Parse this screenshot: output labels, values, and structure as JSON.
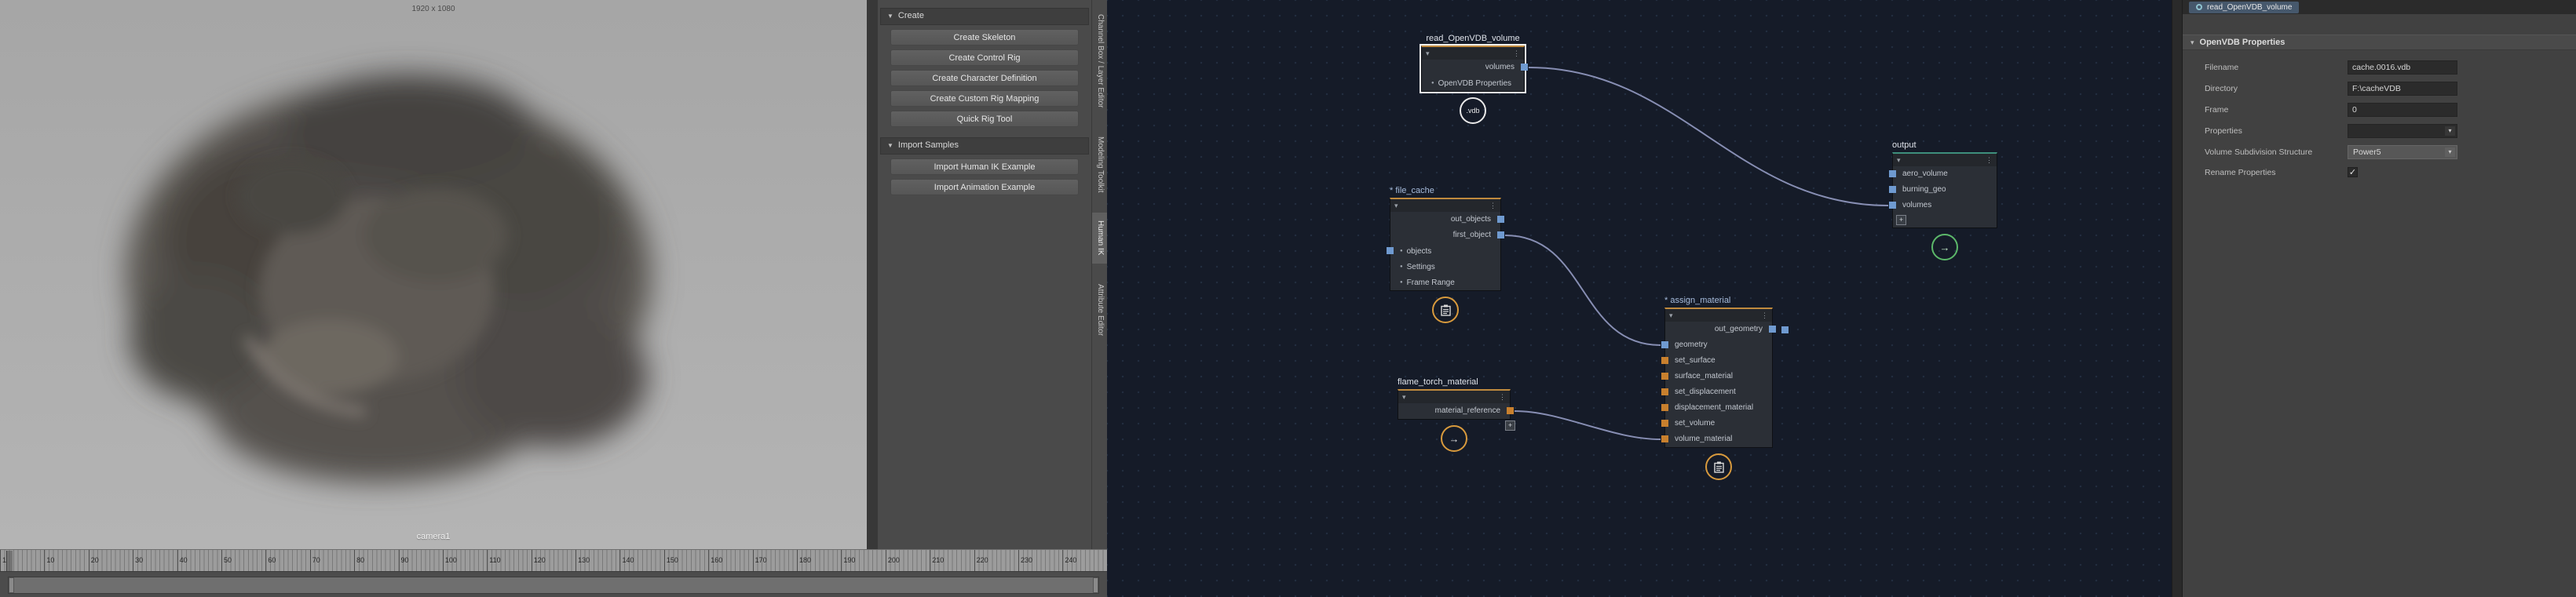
{
  "colors": {
    "wire": "#8d95bb",
    "conn-blue": "#6f9ad0",
    "conn-orange": "#c8802e",
    "badge-yellow": "#d89a3d",
    "badge-green": "#5cb86a",
    "accent-orange": "#c08a3e",
    "accent-teal": "#3e8f7c",
    "selection": "#f2f2f2"
  },
  "icons": {
    "collapse": "▾",
    "dots": "⋮",
    "bullet": "●",
    "plus": "+",
    "arrow_right": "→",
    "chevron_down": "▾",
    "check": "✓",
    "section_triangle": "▼"
  },
  "viewport": {
    "resolution_label": "1920 x 1080",
    "camera_label": "camera1"
  },
  "timeline": {
    "ticks": [
      "1",
      "10",
      "20",
      "30",
      "40",
      "50",
      "60",
      "70",
      "80",
      "90",
      "100",
      "110",
      "120",
      "130",
      "140",
      "150",
      "160",
      "170",
      "180",
      "190",
      "200",
      "210",
      "220",
      "230",
      "240"
    ]
  },
  "humanik": {
    "create_section": {
      "label": "Create",
      "buttons": [
        "Create Skeleton",
        "Create Control Rig",
        "Create Character Definition",
        "Create Custom Rig Mapping",
        "Quick Rig Tool"
      ]
    },
    "import_section": {
      "label": "Import Samples",
      "buttons": [
        "Import Human IK Example",
        "Import Animation Example"
      ]
    }
  },
  "side_tabs": {
    "channel_box": "Channel Box / Layer Editor",
    "modeling_toolkit": "Modeling Toolkit",
    "human_ik": "Human IK",
    "attribute_editor": "Attribute Editor"
  },
  "node_editor": {
    "nodes": {
      "read": {
        "title": "read_OpenVDB_volume",
        "badge": ".vdb",
        "rows": {
          "volumes": "volumes",
          "props": "OpenVDB Properties"
        }
      },
      "output": {
        "title": "output",
        "rows": {
          "aero": "aero_volume",
          "burning": "burning_geo",
          "volumes": "volumes"
        }
      },
      "file_cache": {
        "title": "* file_cache",
        "rows": {
          "out_objects": "out_objects",
          "first_object": "first_object",
          "objects": "objects",
          "settings": "Settings",
          "frame_range": "Frame Range"
        }
      },
      "assign": {
        "title": "* assign_material",
        "rows": {
          "out_geometry": "out_geometry",
          "geometry": "geometry",
          "set_surface": "set_surface",
          "surface_material": "surface_material",
          "set_displacement": "set_displacement",
          "displacement_material": "displacement_material",
          "set_volume": "set_volume",
          "volume_material": "volume_material"
        }
      },
      "flame": {
        "title": "flame_torch_material",
        "rows": {
          "material_reference": "material_reference"
        }
      }
    }
  },
  "params": {
    "header": "read_OpenVDB_volume",
    "section_title": "OpenVDB Properties",
    "fields": {
      "filename": {
        "label": "Filename",
        "value": "cache.0016.vdb"
      },
      "directory": {
        "label": "Directory",
        "value": "F:\\cacheVDB"
      },
      "frame": {
        "label": "Frame",
        "value": "0"
      },
      "properties": {
        "label": "Properties",
        "value": ""
      },
      "subdivision": {
        "label": "Volume Subdivision Structure",
        "value": "Power5"
      },
      "rename": {
        "label": "Rename Properties",
        "checked": true
      }
    }
  }
}
